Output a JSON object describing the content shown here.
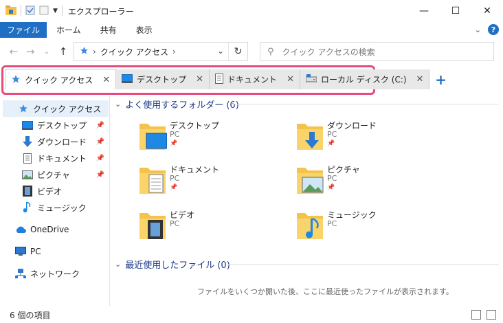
{
  "window": {
    "title": "エクスプローラー",
    "controls": [
      "minimize",
      "maximize",
      "close"
    ]
  },
  "ribbon": {
    "tabs": [
      "ファイル",
      "ホーム",
      "共有",
      "表示"
    ]
  },
  "address": {
    "crumb": "クイック アクセス",
    "search_placeholder": "クイック アクセスの検索"
  },
  "tabs": [
    {
      "label": "クイック アクセス",
      "icon": "star-icon",
      "active": true
    },
    {
      "label": "デスクトップ",
      "icon": "desktop-icon",
      "active": false
    },
    {
      "label": "ドキュメント",
      "icon": "document-icon",
      "active": false
    },
    {
      "label": "ローカル ディスク (C:)",
      "icon": "drive-icon",
      "active": false
    }
  ],
  "sidebar": {
    "items": [
      {
        "label": "クイック アクセス",
        "icon": "star-icon",
        "pinned": false
      },
      {
        "label": "デスクトップ",
        "icon": "desktop-icon",
        "pinned": true
      },
      {
        "label": "ダウンロード",
        "icon": "download-icon",
        "pinned": true
      },
      {
        "label": "ドキュメント",
        "icon": "document-icon",
        "pinned": true
      },
      {
        "label": "ピクチャ",
        "icon": "picture-icon",
        "pinned": true
      },
      {
        "label": "ビデオ",
        "icon": "video-icon",
        "pinned": false
      },
      {
        "label": "ミュージック",
        "icon": "music-icon",
        "pinned": false
      },
      {
        "label": "OneDrive",
        "icon": "cloud-icon",
        "pinned": false
      },
      {
        "label": "PC",
        "icon": "pc-icon",
        "pinned": false
      },
      {
        "label": "ネットワーク",
        "icon": "network-icon",
        "pinned": false
      }
    ]
  },
  "main": {
    "frequent_header": "よく使用するフォルダー (6)",
    "recent_header": "最近使用したファイル (0)",
    "empty_message": "ファイルをいくつか開いた後、ここに最近使ったファイルが表示されます。",
    "folders": [
      {
        "name": "デスクトップ",
        "location": "PC",
        "pinned": true,
        "icon": "desktop-folder-icon"
      },
      {
        "name": "ダウンロード",
        "location": "PC",
        "pinned": true,
        "icon": "download-folder-icon"
      },
      {
        "name": "ドキュメント",
        "location": "PC",
        "pinned": true,
        "icon": "document-folder-icon"
      },
      {
        "name": "ピクチャ",
        "location": "PC",
        "pinned": true,
        "icon": "picture-folder-icon"
      },
      {
        "name": "ビデオ",
        "location": "PC",
        "pinned": false,
        "icon": "video-folder-icon"
      },
      {
        "name": "ミュージック",
        "location": "PC",
        "pinned": false,
        "icon": "music-folder-icon"
      }
    ]
  },
  "status": {
    "item_count": "6 個の項目"
  },
  "colors": {
    "accent": "#1f6fc4",
    "highlight_frame": "#e84a7a",
    "folder": "#f5c34b"
  }
}
